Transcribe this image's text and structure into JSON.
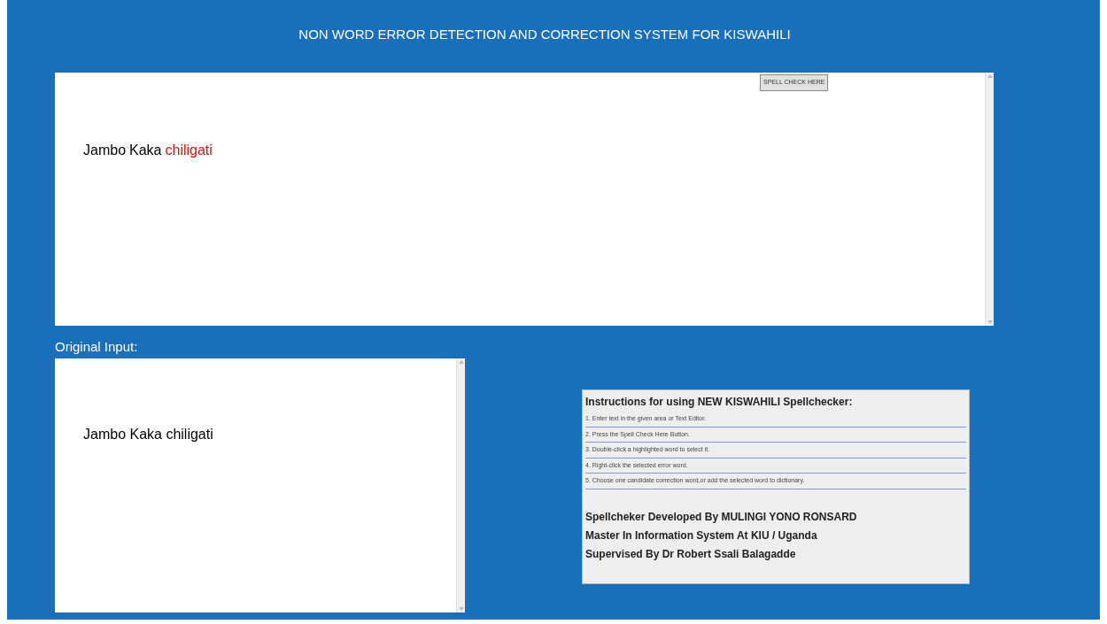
{
  "title": "NON WORD ERROR DETECTION AND CORRECTION SYSTEM FOR KISWAHILI",
  "editor": {
    "words": [
      {
        "text": "Jambo",
        "error": false
      },
      {
        "text": "Kaka",
        "error": false
      },
      {
        "text": "chiligati",
        "error": true
      }
    ],
    "button": "SPELL CHECK HERE"
  },
  "original_input": {
    "label": "Original Input:",
    "value": "Jambo Kaka chiligati"
  },
  "instructions": {
    "heading": "Instructions for using NEW KISWAHILI Spellchecker:",
    "steps": [
      "1. Enter text in the given area or Text Editor.",
      "2. Press the Spell Check Here Button.",
      "3. Double-click a highlighted word to select it.",
      "4. Right-click the selected error word.",
      "5. Choose one candidate correction word,or add the selected word to dictionary."
    ],
    "credits": [
      "Spellcheker Developed By MULINGI YONO RONSARD",
      "Master In Information System At KIU / Uganda",
      "Supervised By Dr Robert Ssali Balagadde"
    ]
  }
}
